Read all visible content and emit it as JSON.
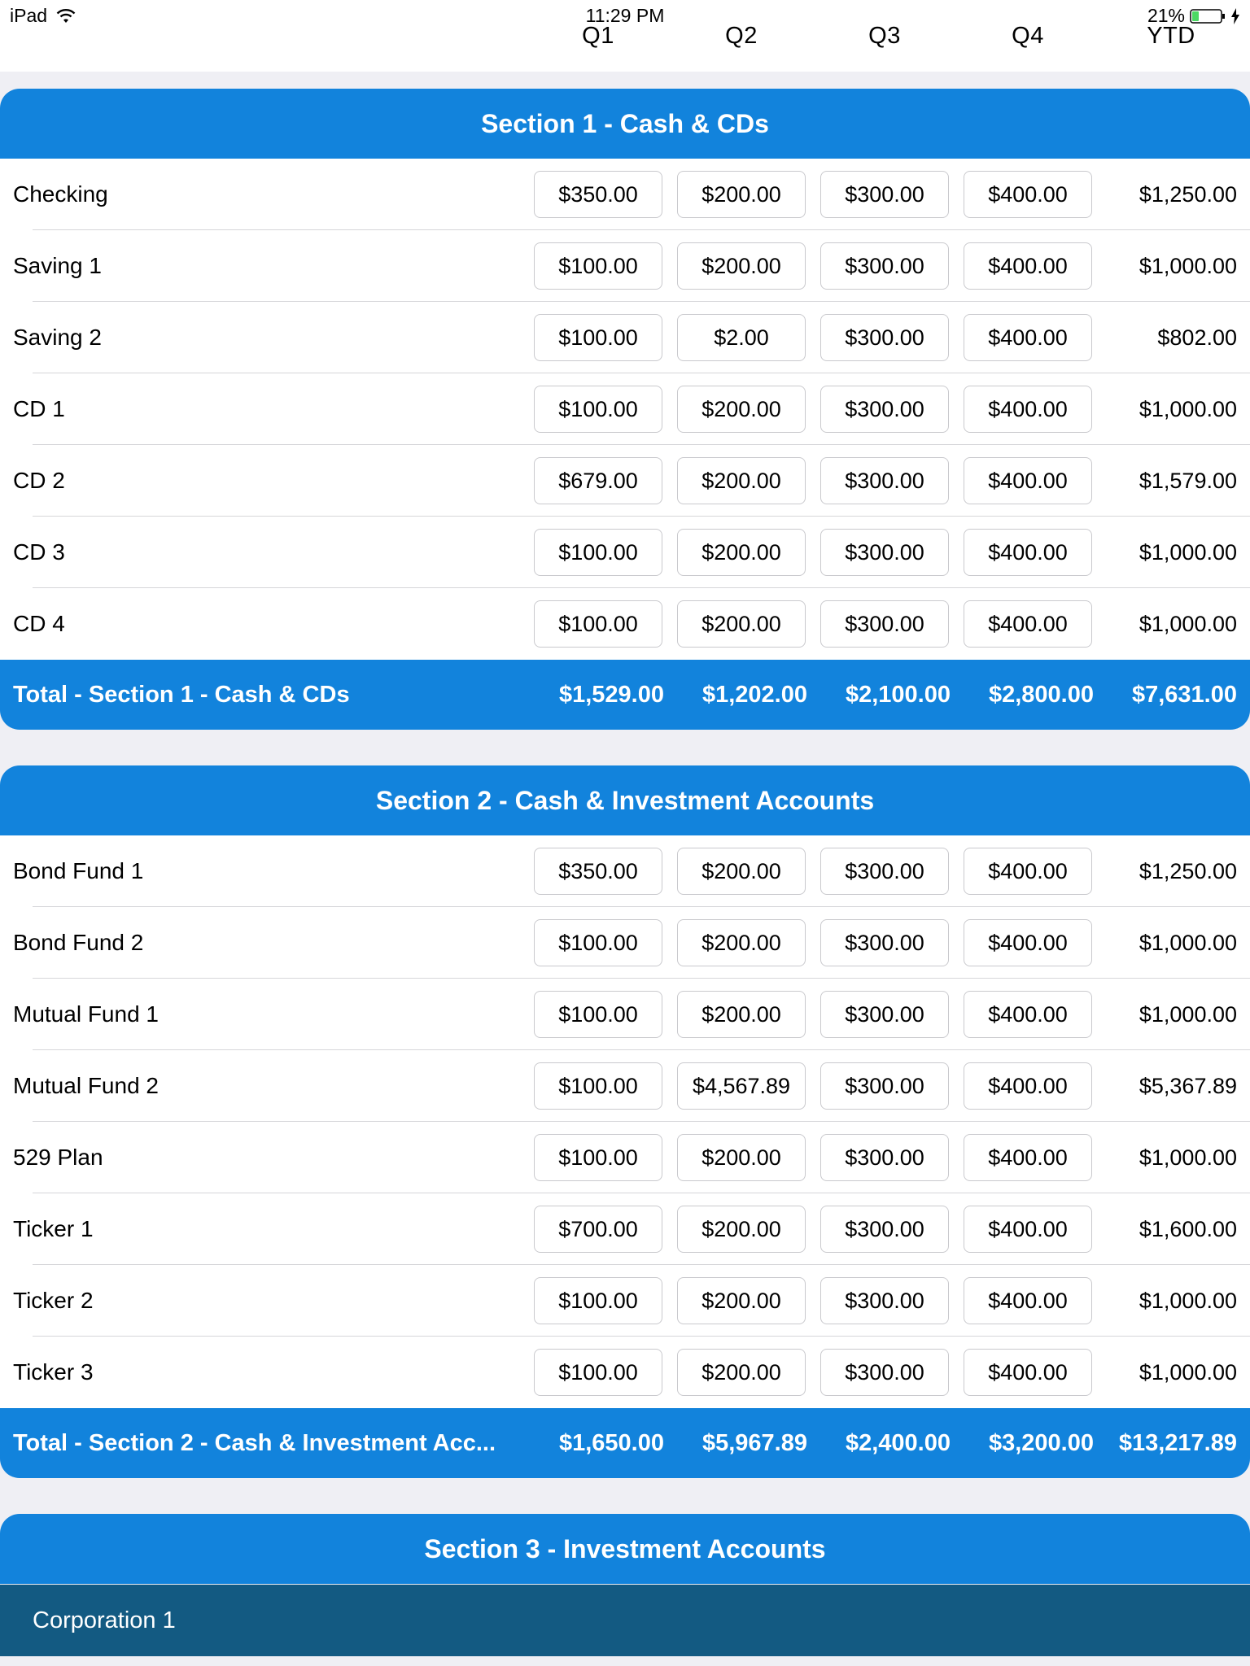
{
  "status_bar": {
    "device": "iPad",
    "time": "11:29 PM",
    "battery": "21%"
  },
  "columns": [
    "Q1",
    "Q2",
    "Q3",
    "Q4",
    "YTD"
  ],
  "sections": [
    {
      "title": "Section 1 - Cash & CDs",
      "rows": [
        {
          "label": "Checking",
          "q1": "$350.00",
          "q2": "$200.00",
          "q3": "$300.00",
          "q4": "$400.00",
          "ytd": "$1,250.00"
        },
        {
          "label": "Saving 1",
          "q1": "$100.00",
          "q2": "$200.00",
          "q3": "$300.00",
          "q4": "$400.00",
          "ytd": "$1,000.00"
        },
        {
          "label": "Saving 2",
          "q1": "$100.00",
          "q2": "$2.00",
          "q3": "$300.00",
          "q4": "$400.00",
          "ytd": "$802.00"
        },
        {
          "label": "CD 1",
          "q1": "$100.00",
          "q2": "$200.00",
          "q3": "$300.00",
          "q4": "$400.00",
          "ytd": "$1,000.00"
        },
        {
          "label": "CD 2",
          "q1": "$679.00",
          "q2": "$200.00",
          "q3": "$300.00",
          "q4": "$400.00",
          "ytd": "$1,579.00"
        },
        {
          "label": "CD 3",
          "q1": "$100.00",
          "q2": "$200.00",
          "q3": "$300.00",
          "q4": "$400.00",
          "ytd": "$1,000.00"
        },
        {
          "label": "CD 4",
          "q1": "$100.00",
          "q2": "$200.00",
          "q3": "$300.00",
          "q4": "$400.00",
          "ytd": "$1,000.00"
        }
      ],
      "total": {
        "label": "Total - Section 1 - Cash & CDs",
        "q1": "$1,529.00",
        "q2": "$1,202.00",
        "q3": "$2,100.00",
        "q4": "$2,800.00",
        "ytd": "$7,631.00"
      }
    },
    {
      "title": "Section 2 - Cash & Investment Accounts",
      "rows": [
        {
          "label": "Bond Fund 1",
          "q1": "$350.00",
          "q2": "$200.00",
          "q3": "$300.00",
          "q4": "$400.00",
          "ytd": "$1,250.00"
        },
        {
          "label": "Bond Fund 2",
          "q1": "$100.00",
          "q2": "$200.00",
          "q3": "$300.00",
          "q4": "$400.00",
          "ytd": "$1,000.00"
        },
        {
          "label": "Mutual Fund 1",
          "q1": "$100.00",
          "q2": "$200.00",
          "q3": "$300.00",
          "q4": "$400.00",
          "ytd": "$1,000.00"
        },
        {
          "label": "Mutual Fund 2",
          "q1": "$100.00",
          "q2": "$4,567.89",
          "q3": "$300.00",
          "q4": "$400.00",
          "ytd": "$5,367.89"
        },
        {
          "label": "529 Plan",
          "q1": "$100.00",
          "q2": "$200.00",
          "q3": "$300.00",
          "q4": "$400.00",
          "ytd": "$1,000.00"
        },
        {
          "label": "Ticker 1",
          "q1": "$700.00",
          "q2": "$200.00",
          "q3": "$300.00",
          "q4": "$400.00",
          "ytd": "$1,600.00"
        },
        {
          "label": "Ticker 2",
          "q1": "$100.00",
          "q2": "$200.00",
          "q3": "$300.00",
          "q4": "$400.00",
          "ytd": "$1,000.00"
        },
        {
          "label": "Ticker 3",
          "q1": "$100.00",
          "q2": "$200.00",
          "q3": "$300.00",
          "q4": "$400.00",
          "ytd": "$1,000.00"
        }
      ],
      "total": {
        "label": "Total - Section 2 - Cash & Investment Acc...",
        "q1": "$1,650.00",
        "q2": "$5,967.89",
        "q3": "$2,400.00",
        "q4": "$3,200.00",
        "ytd": "$13,217.89"
      }
    },
    {
      "title": "Section 3 - Investment Accounts",
      "rows": [],
      "group_rows": [
        {
          "label": "Corporation 1"
        }
      ]
    }
  ],
  "colors": {
    "accent": "#1283dc",
    "group_row": "#135a82",
    "background": "#efeff4"
  }
}
